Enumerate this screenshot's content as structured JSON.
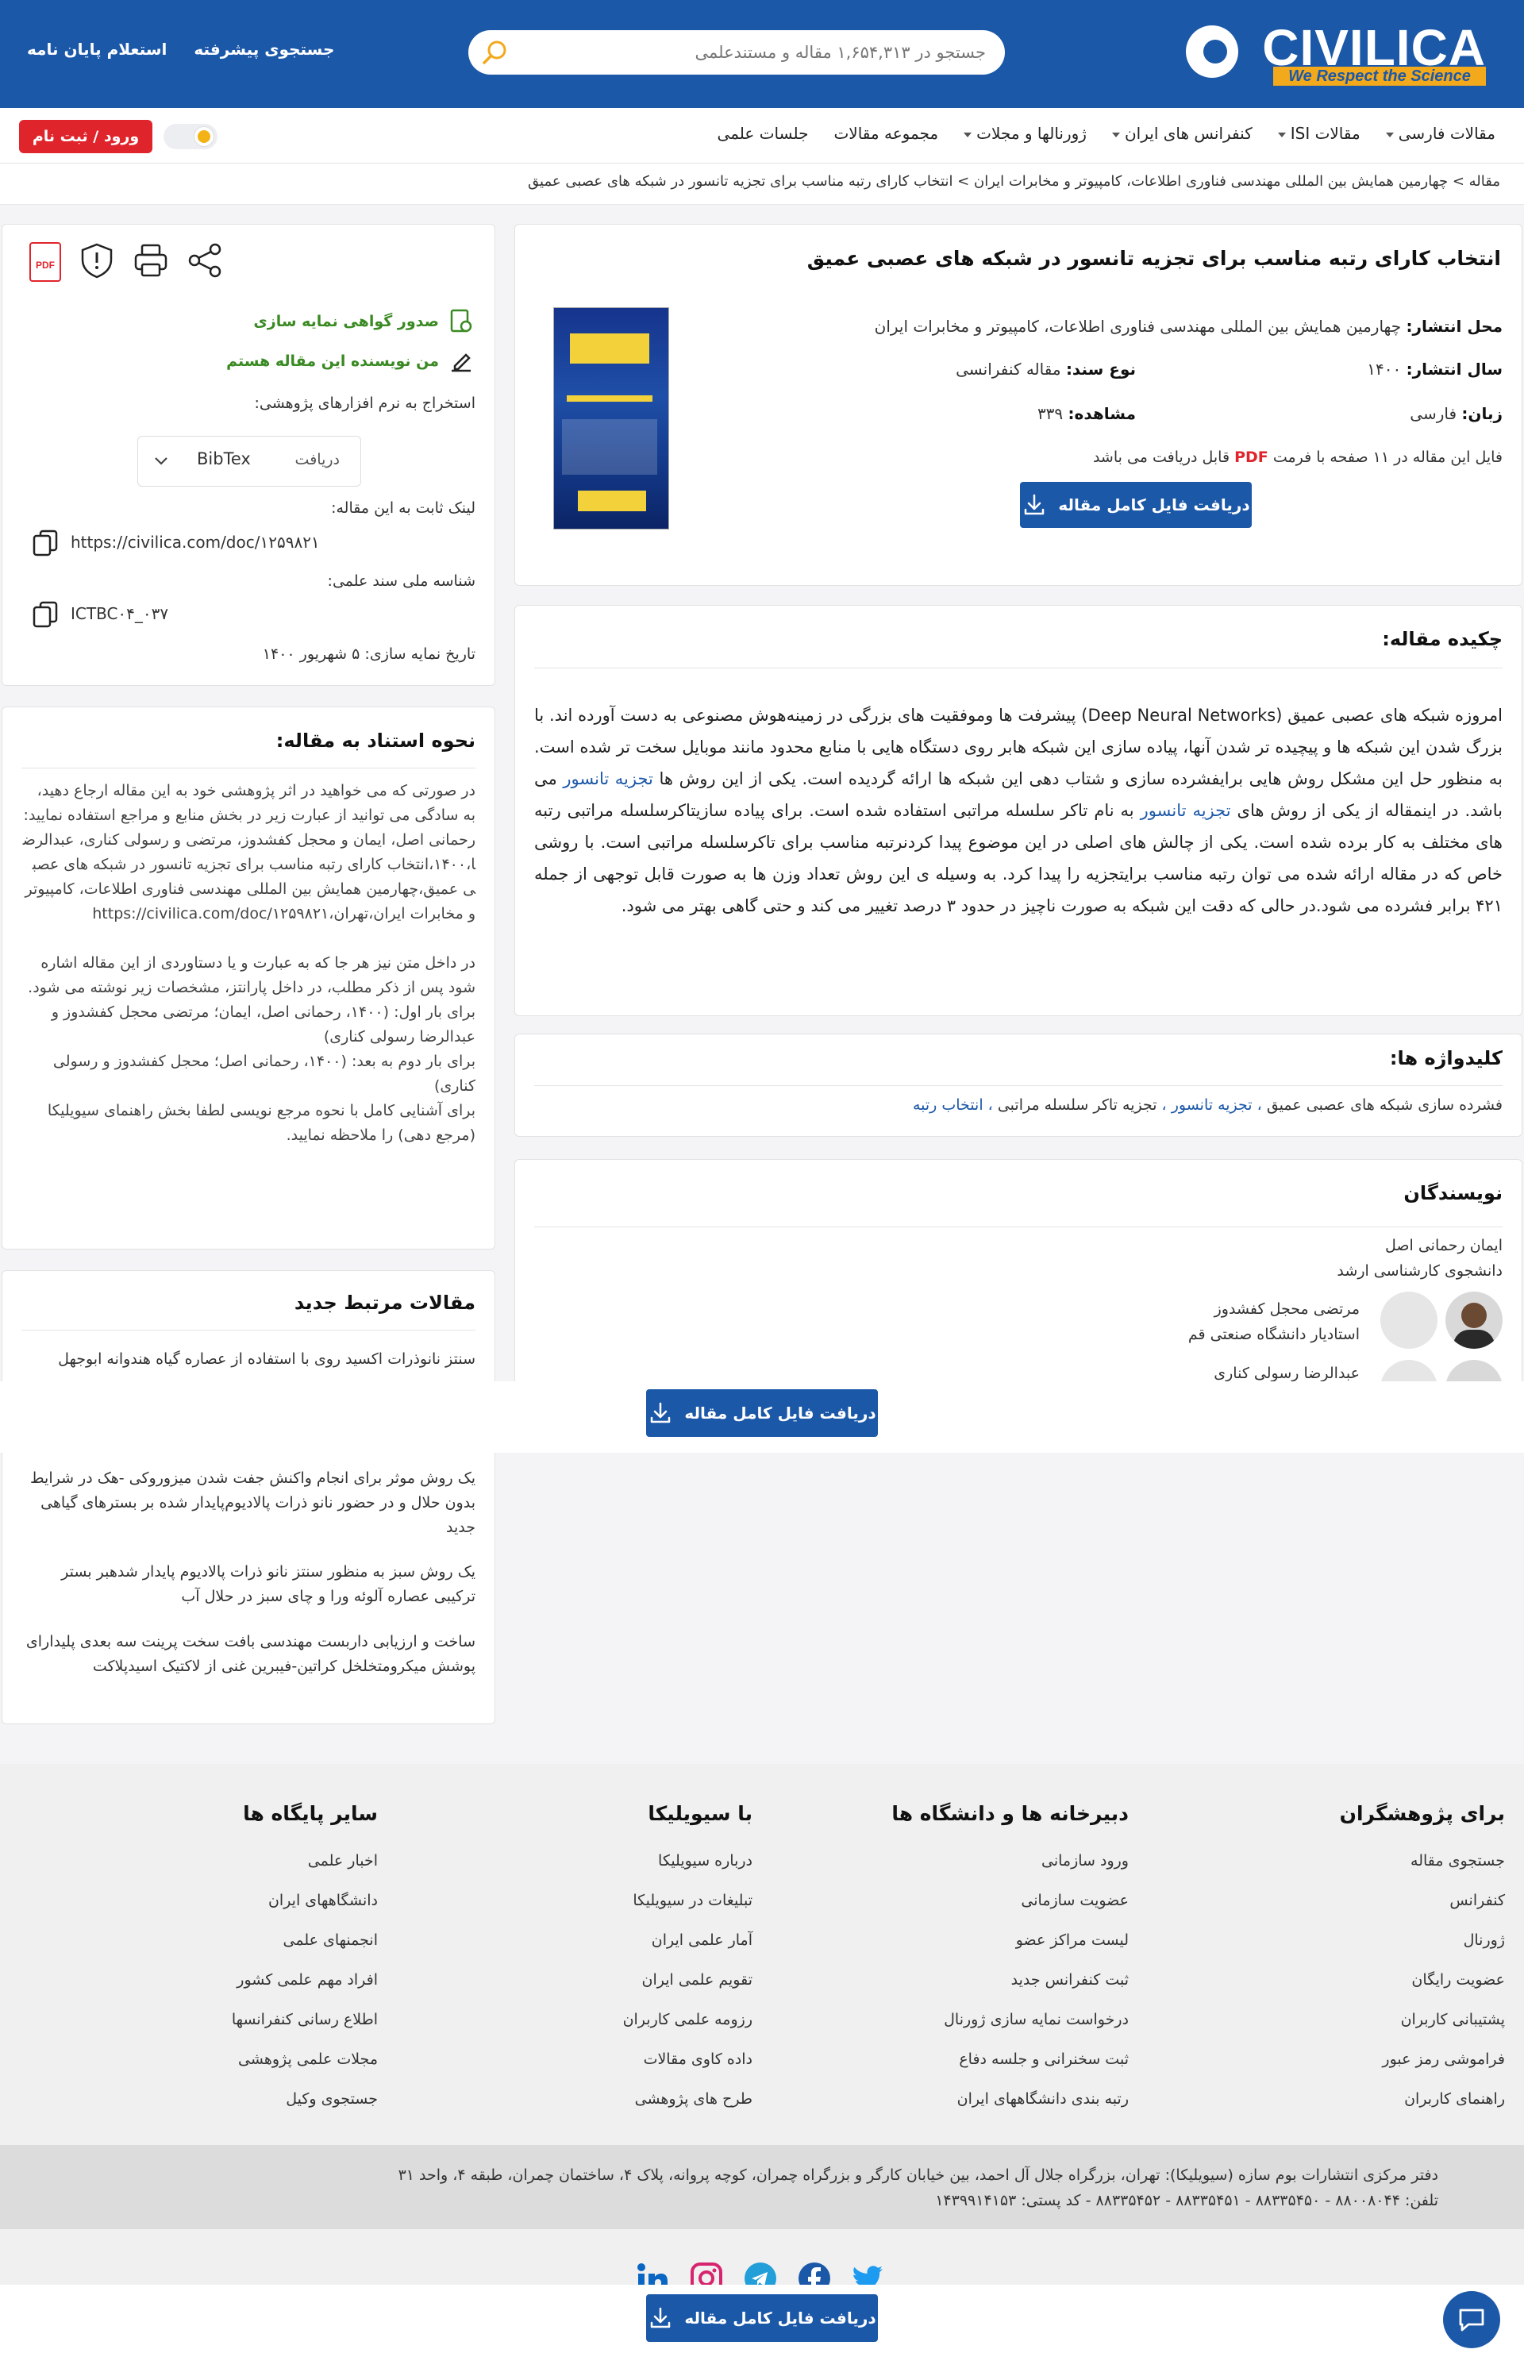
{
  "header": {
    "logo_text": "CIVILICA",
    "logo_tagline": "We Respect the Science",
    "search_placeholder": "جستجو در ۱,۶۵۴,۳۱۳ مقاله و مستندعلمی",
    "advanced_search": "جستجوی پیشرفته",
    "thesis_inquiry": "استعلام پایان نامه"
  },
  "nav": {
    "items": [
      "مقالات فارسی",
      "مقالات ISI",
      "کنفرانس های ایران",
      "ژورنالها و مجلات",
      "مجموعه مقالات",
      "جلسات علمی"
    ],
    "login": "ورود / ثبت نام"
  },
  "breadcrumb": "مقاله > چهارمین همایش بین المللی مهندسی فناوری اطلاعات، کامپیوتر و مخابرات ایران > انتخاب کارای رتبه مناسب برای تجزیه تانسور در شبکه های عصبی عمیق",
  "paper": {
    "title": "انتخاب کارای رتبه مناسب برای تجزیه تانسور در شبکه های عصبی عمیق",
    "publisher_label": "محل انتشار:",
    "publisher": "چهارمین همایش بین المللی مهندسی فناوری اطلاعات، کامپیوتر و مخابرات ایران",
    "year_label": "سال انتشار:",
    "year": "۱۴۰۰",
    "doc_type_label": "نوع سند:",
    "doc_type": "مقاله کنفرانسی",
    "language_label": "زبان:",
    "language": "فارسی",
    "views_label": "مشاهده:",
    "views": "۳۳۹",
    "file_note_a": "فایل این مقاله در ۱۱ صفحه با فرمت",
    "file_format": "PDF",
    "file_note_b": "قابل دریافت می باشد",
    "download": "دریافت فایل کامل مقاله"
  },
  "abstract": {
    "title": "چکیده مقاله:",
    "p1": "امروزه شبکه های عصبی عمیق (Deep Neural Networks) پیشرفت ها وموفقیت های بزرگی در زمینه‌هوش مصنوعی به دست آورده اند. با بزرگ شدن این شبکه ها و پیچیده تر شدن آنها، پیاده سازی این شبکه هابر روی دستگاه هایی با منابع محدود مانند موبایل سخت تر شده است. به منظور حل این مشکل روش هایی برایفشرده سازی و شتاب دهی این شبکه ها ارائه گردیده است. یکی از این روش ها",
    "kw1": "تجزیه تانسور",
    "p2": "می باشد. در اینمقاله از یکی از روش های",
    "kw2": "تجزیه تانسور",
    "p3": "به نام تاکر سلسله مراتبی استفاده شده است. برای پیاده سازیتاکرسلسله مراتبی رتبه های مختلف به کار برده شده است. یکی از چالش های اصلی در این موضوع پیدا کردنرتبه مناسب برای تاکرسلسله مراتبی است. با روشی خاص که در مقاله ارائه شده می توان رتبه مناسب برایتجزیه را پیدا کرد. به وسیله ی این روش تعداد وزن ها به صورت قابل توجهی از جمله ۴۲۱ برابر فشرده می شود.در حالی که دقت این شبکه به صورت ناچیز در حدود ۳ درصد تغییر می کند و حتی گاهی بهتر می شود."
  },
  "keywords": {
    "title": "کلیدواژه ها:",
    "items": [
      "فشرده سازی شبکه های عصبی عمیق",
      "تجزیه تانسور",
      "تجزیه تاکر سلسله مراتبی",
      "انتخاب رتبه"
    ]
  },
  "authors": {
    "title": "نویسندگان",
    "list": [
      {
        "name": "ایمان رحمانی اصل",
        "role": "دانشجوی کارشناسی ارشد"
      },
      {
        "name": "مرتضی محجل کفشدوز",
        "role": "استادیار دانشگاه صنعتی قم"
      },
      {
        "name": "عبدالرضا رسولی کناری",
        "role": ""
      }
    ]
  },
  "side": {
    "cert": "صدور گواهی نمایه سازی",
    "i_am_author": "من نویسنده این مقاله هستم",
    "extract_label": "استخراج به نرم افزارهای پژوهشی:",
    "bibtex": "BibTex",
    "get": "دریافت",
    "permalink_label": "لینک ثابت به این مقاله:",
    "permalink": "https://civilica.com/doc/۱۲۵۹۸۲۱",
    "docid_label": "شناسه ملی سند علمی:",
    "docid": "ICTBC۰۴_۰۳۷",
    "index_date": "تاریخ نمایه سازی: ۵ شهریور ۱۴۰۰",
    "pdf_icon": "PDF"
  },
  "cite": {
    "title": "نحوه استناد به مقاله:",
    "text": "در صورتی که می خواهید در اثر پژوهشی خود به این مقاله ارجاع دهید، به سادگی می توانید از عبارت زیر در بخش منابع و مراجع استفاده نمایید:",
    "ref": "رحمانی اصل، ایمان و محجل کفشدوز، مرتضی و رسولی کناری، عبدالرضا،۱۴۰۰،انتخاب کارای رتبه مناسب برای تجزیه تانسور در شبکه های عصبی عمیق،چهارمین همایش بین المللی مهندسی فناوری اطلاعات، کامپیوتر و مخابرات ایران،تهران،https://civilica.com/doc/۱۲۵۹۸۲۱",
    "intext": "در داخل متن نیز هر جا که به عبارت و یا دستاوردی از این مقاله اشاره شود پس از ذکر مطلب، در داخل پارانتز، مشخصات زیر نوشته می شود.",
    "first": "برای بار اول: (۱۴۰۰، رحمانی اصل، ایمان؛ مرتضی محجل کفشدوز و عبدالرضا رسولی کناری)",
    "second": "برای بار دوم به بعد: (۱۴۰۰، رحمانی اصل؛ محجل کفشدوز و رسولی کناری)",
    "guide": "برای آشنایی کامل با نحوه مرجع نویسی لطفا بخش راهنمای سیویلیکا (مرجع دهی) را ملاحظه نمایید."
  },
  "related": {
    "title": "مقالات مرتبط جدید",
    "items": [
      "سنتز نانوذرات اکسید روی با استفاده از عصاره گیاه هندوانه ابوجهل",
      "یک روش موثر برای انجام واکنش جفت شدن میزوروکی -هک در شرایط بدون حلال و در حضور نانو ذرات پالادیوم‌پایدار شده بر بسترهای گیاهی جدید",
      "یک روش سبز به منظور سنتز نانو ذرات پالادیوم پایدار شدهبر بستر ترکیبی عصاره آلوئه ورا و چای سبز در حلال آب",
      "ساخت و ارزیابی داربست مهندسی بافت سخت پرینت سه بعدی پلیدارای پوشش میکرومتخلخل کراتین-فیبرین غنی از لاکتیک اسیدپلاکت"
    ]
  },
  "footer": {
    "col1": {
      "title": "برای پژوهشگران",
      "items": [
        "جستجوی مقاله",
        "کنفرانس",
        "ژورنال",
        "عضویت رایگان",
        "پشتیبانی کاربران",
        "فراموشی رمز عبور",
        "راهنمای کاربران"
      ]
    },
    "col2": {
      "title": "دبیرخانه ها و دانشگاه ها",
      "items": [
        "ورود سازمانی",
        "عضویت سازمانی",
        "لیست مراکز عضو",
        "ثبت کنفرانس جدید",
        "درخواست نمایه سازی ژورنال",
        "ثبت سخنرانی و جلسه دفاع",
        "رتبه بندی دانشگاههای ایران"
      ]
    },
    "col3": {
      "title": "با سیویلیکا",
      "items": [
        "درباره سیویلیکا",
        "تبلیغات در سیویلیکا",
        "آمار علمی ایران",
        "تقویم علمی ایران",
        "رزومه علمی کاربران",
        "داده کاوی مقالات",
        "طرح های پژوهشی"
      ]
    },
    "col4": {
      "title": "سایر پایگاه ها",
      "items": [
        "اخبار علمی",
        "دانشگاههای ایران",
        "انجمنهای علمی",
        "افراد مهم علمی کشور",
        "اطلاع رسانی کنفرانسها",
        "مجلات علمی پژوهشی",
        "جستجوی وکیل"
      ]
    },
    "address": "دفتر مرکزی انتشارات بوم سازه (سیویلیکا): تهران، بزرگراه جلال آل احمد، بین خیابان کارگر و بزرگراه چمران، کوچه پروانه، پلاک ۴، ساختمان چمران، طبقه ۴، واحد ۳۱",
    "phones": "تلفن: ۸۸۰۰۸۰۴۴ - ۸۸۳۳۵۴۵۰ - ۸۸۳۳۵۴۵۱ - ۸۸۳۳۵۴۵۲ - کد پستی: ۱۴۳۹۹۱۴۱۵۳"
  },
  "colors": {
    "brand": "#1c58a8",
    "accent": "#f2a91c",
    "login": "#e0242b",
    "ok": "#3a8a23"
  }
}
